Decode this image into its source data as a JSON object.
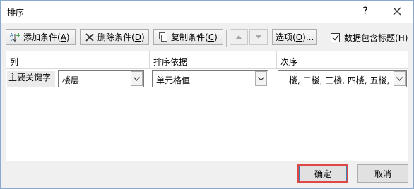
{
  "window": {
    "title": "排序",
    "help_label": "?"
  },
  "toolbar": {
    "add_level": {
      "label": "添加条件(",
      "key": "A",
      "suffix": ")"
    },
    "delete_level": {
      "label": "删除条件(",
      "key": "D",
      "suffix": ")"
    },
    "copy_level": {
      "label": "复制条件(",
      "key": "C",
      "suffix": ")"
    },
    "options": {
      "label": "选项(",
      "key": "O",
      "suffix": ")..."
    },
    "has_headers": {
      "label": "数据包含标题(",
      "key": "H",
      "suffix": ")",
      "checked": true
    }
  },
  "grid": {
    "headers": {
      "column": "列",
      "sort_on": "排序依据",
      "order": "次序"
    },
    "rows": [
      {
        "label": "主要关键字",
        "column": "楼层",
        "sort_on": "单元格值",
        "order": "一楼, 二楼, 三楼, 四楼, 五楼, 六"
      }
    ]
  },
  "footer": {
    "ok_label": "确定",
    "cancel_label": "取消"
  },
  "colors": {
    "accent_highlight": "#e04848",
    "border": "#9d9d9d"
  },
  "icons": [
    "add-sort-level-icon",
    "delete-x-icon",
    "copy-icon",
    "move-up-icon",
    "move-down-icon",
    "checkbox-check-icon",
    "close-icon",
    "chevron-down-icon"
  ]
}
